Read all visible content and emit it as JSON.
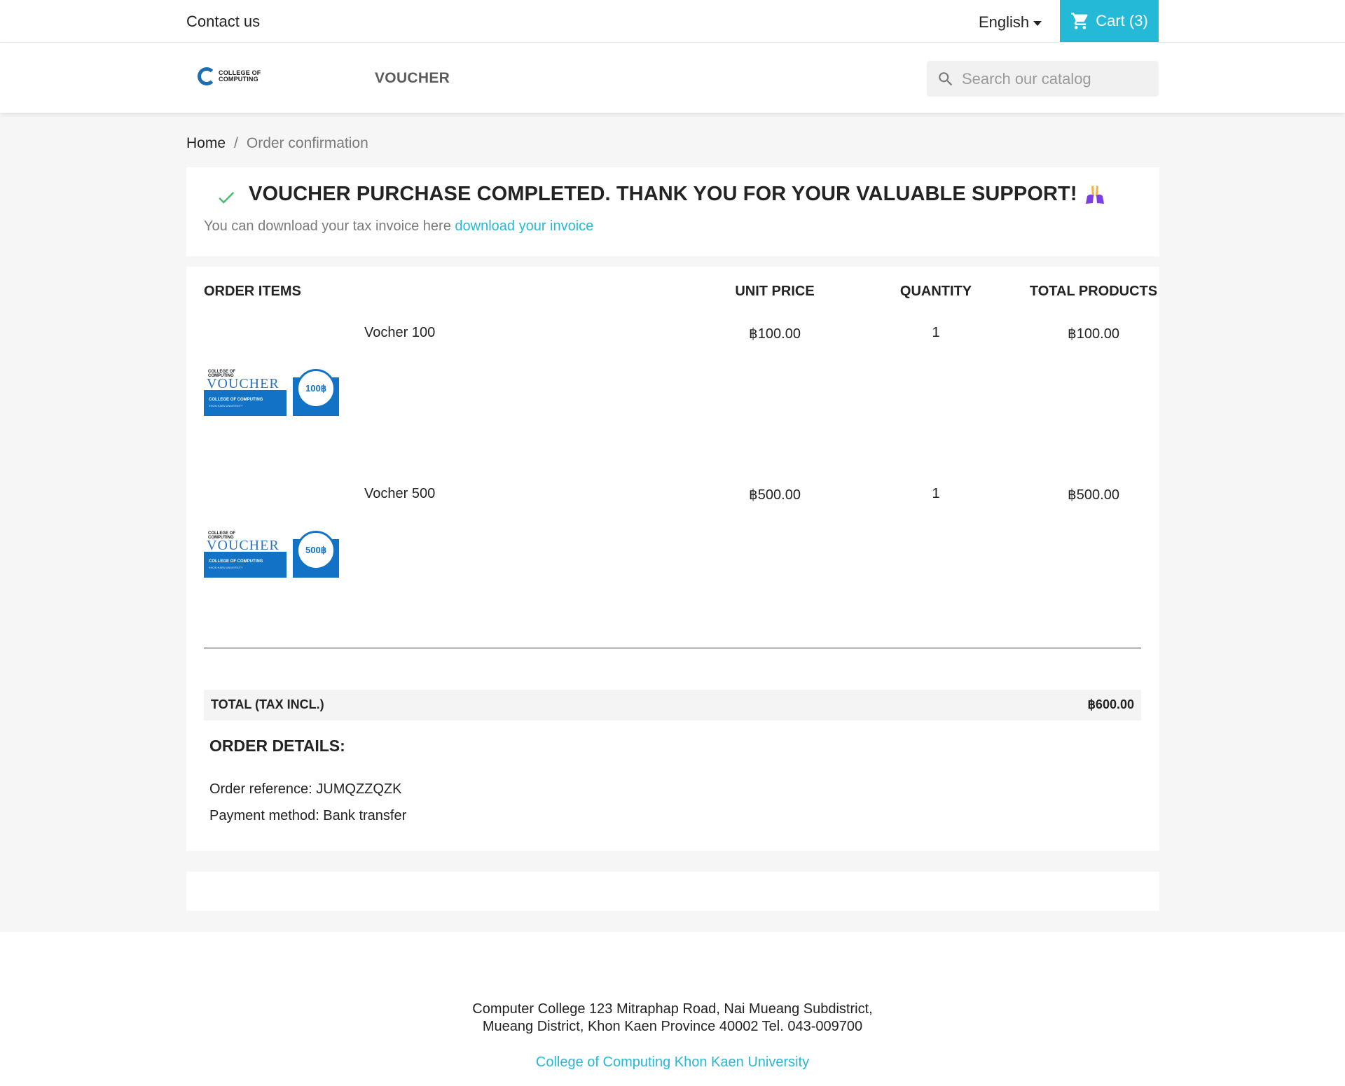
{
  "topbar": {
    "contact": "Contact us",
    "language": "English",
    "cart_label": "Cart (3)"
  },
  "header": {
    "logo_line1": "COLLEGE OF",
    "logo_line2": "COMPUTING",
    "nav_item": "VOUCHER",
    "search_placeholder": "Search our catalog"
  },
  "breadcrumb": {
    "home": "Home",
    "separator": "/",
    "current": "Order confirmation"
  },
  "confirmation": {
    "title": "VOUCHER PURCHASE COMPLETED. THANK YOU FOR YOUR VALUABLE SUPPORT!",
    "invoice_text": "You can download your tax invoice here",
    "invoice_link": "download your invoice"
  },
  "order": {
    "headers": {
      "items": "ORDER ITEMS",
      "unit_price": "UNIT PRICE",
      "quantity": "QUANTITY",
      "total": "TOTAL PRODUCTS"
    },
    "items": [
      {
        "name": "Vocher 100",
        "unit_price": "฿100.00",
        "quantity": "1",
        "total": "฿100.00",
        "image_word": "VOUCHER",
        "image_college": "COLLEGE OF COMPUTING",
        "image_univ": "KHON KAEN UNIVERSITY",
        "image_badge": "100฿"
      },
      {
        "name": "Vocher 500",
        "unit_price": "฿500.00",
        "quantity": "1",
        "total": "฿500.00",
        "image_word": "VOUCHER",
        "image_college": "COLLEGE OF COMPUTING",
        "image_univ": "KHON KAEN UNIVERSITY",
        "image_badge": "500฿"
      }
    ],
    "total_label": "TOTAL (TAX INCL.)",
    "total_value": "฿600.00"
  },
  "details": {
    "title": "ORDER DETAILS:",
    "reference": "Order reference: JUMQZZQZK",
    "payment": "Payment method: Bank transfer"
  },
  "footer": {
    "address_line1": "Computer College 123 Mitraphap Road, Nai Mueang Subdistrict,",
    "address_line2": "Mueang District, Khon Kaen Province 40002 Tel. 043-009700",
    "link": "College of Computing Khon Kaen University"
  },
  "colors": {
    "accent": "#24b9d7",
    "check": "#4cbb6c",
    "voucher_blue": "#1273c6"
  },
  "icons": {
    "cart": "cart-icon",
    "search": "search-icon",
    "check": "check-icon",
    "pray": "folded-hands-icon",
    "caret": "caret-down-icon"
  }
}
